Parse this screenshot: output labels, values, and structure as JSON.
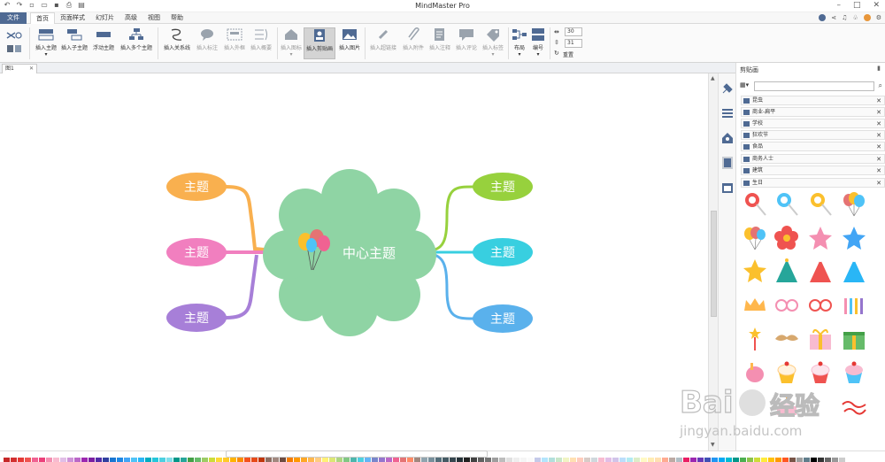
{
  "window": {
    "title": "MindMaster Pro"
  },
  "menu": {
    "file": "文件",
    "tabs": [
      "首页",
      "页面样式",
      "幻灯片",
      "高级",
      "视图",
      "帮助"
    ],
    "active": 0
  },
  "ribbon": {
    "insert_topic": "插入主题",
    "insert_subtopic": "插入子主题",
    "floating_topic": "浮动主题",
    "insert_multiple": "插入多个主题",
    "insert_relation": "插入关系线",
    "insert_callout": "插入标注",
    "insert_boundary": "插入外框",
    "insert_summary": "插入概要",
    "insert_icon": "插入图标",
    "insert_clipart": "插入剪贴画",
    "insert_image": "插入图片",
    "insert_hyperlink": "插入超链接",
    "insert_attachment": "插入附件",
    "insert_note": "插入注释",
    "insert_comment": "插入评论",
    "insert_tag": "插入标签",
    "layout": "布局",
    "numbering": "编号",
    "spin1": "30",
    "spin2": "31",
    "reset": "重置"
  },
  "doc_tab": {
    "name": "图1"
  },
  "mindmap": {
    "central": "中心主题",
    "topics": [
      "主题",
      "主题",
      "主题",
      "主题",
      "主题",
      "主题"
    ]
  },
  "panel": {
    "title": "剪贴画",
    "categories": [
      "昆虫",
      "商业-扁平",
      "学校",
      "狂欢节",
      "食品",
      "商务人士",
      "建筑",
      "生日"
    ]
  },
  "watermark": {
    "text1": "Bai",
    "text2": "经验",
    "url": "jingyan.baidu.com"
  },
  "colors": {
    "accent": "#4f6a93",
    "cloud": "#8fd4a4",
    "orange": "#f9b04f",
    "pink": "#f17fbf",
    "purple": "#a77fd8",
    "green": "#97d13d",
    "cyan": "#38cfe0",
    "blue": "#5ab1ec"
  }
}
